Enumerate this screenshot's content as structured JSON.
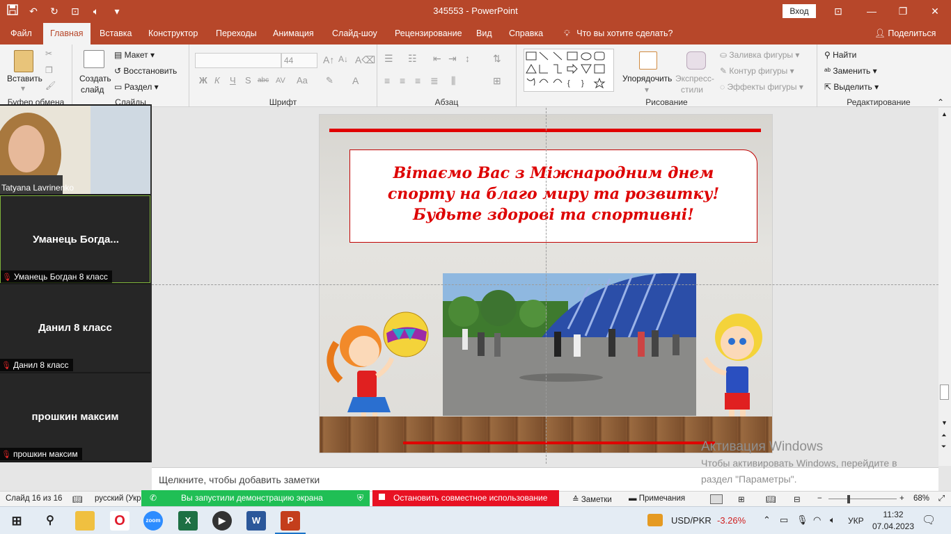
{
  "window": {
    "doc_title": "345553 - PowerPoint",
    "signin": "Вход",
    "minimize": "—",
    "restore": "❐",
    "close": "✕",
    "ribbon_display": "⊡"
  },
  "tabs": {
    "items": [
      "Файл",
      "Главная",
      "Вставка",
      "Конструктор",
      "Переходы",
      "Анимация",
      "Слайд-шоу",
      "Рецензирование",
      "Вид",
      "Справка"
    ],
    "active": "Главная",
    "tell_me": "Что вы хотите сделать?",
    "share": "Поделиться"
  },
  "ribbon": {
    "clipboard": {
      "paste": "Вставить",
      "label": "Буфер обмена"
    },
    "slides": {
      "new_slide_1": "Создать",
      "new_slide_2": "слайд",
      "layout": "Макет",
      "reset": "Восстановить",
      "section": "Раздел",
      "label": "Слайды"
    },
    "font": {
      "size": "44",
      "label": "Шрифт",
      "bold": "Ж",
      "italic": "К",
      "underline": "Ч",
      "shadow": "S",
      "strike": "abc",
      "spacing": "AV",
      "case": "Aa",
      "color": "A"
    },
    "paragraph": {
      "label": "Абзац"
    },
    "drawing": {
      "arrange": "Упорядочить",
      "quick_styles_1": "Экспресс-",
      "quick_styles_2": "стили",
      "fill": "Заливка фигуры",
      "outline": "Контур фигуры",
      "effects": "Эффекты фигуры",
      "label": "Рисование"
    },
    "editing": {
      "find": "Найти",
      "replace": "Заменить",
      "select": "Выделить",
      "label": "Редактирование"
    }
  },
  "slide": {
    "greeting_line1": "Вітаємо Вас з Міжнародним днем",
    "greeting_line2": "спорту на благо миру та розвитку!",
    "greeting_line3": "Будьте здорові та спортивні!"
  },
  "notes_placeholder": "Щелкните, чтобы добавить заметки",
  "activation": {
    "title": "Активация Windows",
    "line1": "Чтобы активировать Windows, перейдите в",
    "line2": "раздел \"Параметры\"."
  },
  "statusbar": {
    "slide_count": "Слайд 16 из 16",
    "language": "русский (Укр",
    "notes": "Заметки",
    "comments": "Примечания",
    "zoom": "68%"
  },
  "screenshare": {
    "sharing": "Вы запустили демонстрацию экрана",
    "stop": "Остановить совместное использование"
  },
  "zoom_panel": {
    "participants": [
      {
        "display": "",
        "tag": "Tatyana Lavrinenko"
      },
      {
        "display": "Уманець  Богда...",
        "tag": "Уманець Богдан 8 класс"
      },
      {
        "display": "Данил 8 класс",
        "tag": "Данил 8 класс"
      },
      {
        "display": "прошкин максим",
        "tag": "прошкин максим"
      }
    ]
  },
  "taskbar": {
    "ticker": "USD/PKR",
    "ticker_change": "-3.26%",
    "keyboard": "УКР",
    "time": "11:32",
    "date": "07.04.2023",
    "apps": [
      "file-explorer",
      "opera",
      "zoom",
      "excel",
      "media-player",
      "word",
      "powerpoint"
    ]
  },
  "colors": {
    "accent": "#b7472a",
    "greeting": "#dd0000",
    "share_green": "#20bf55",
    "share_red": "#e81123"
  }
}
